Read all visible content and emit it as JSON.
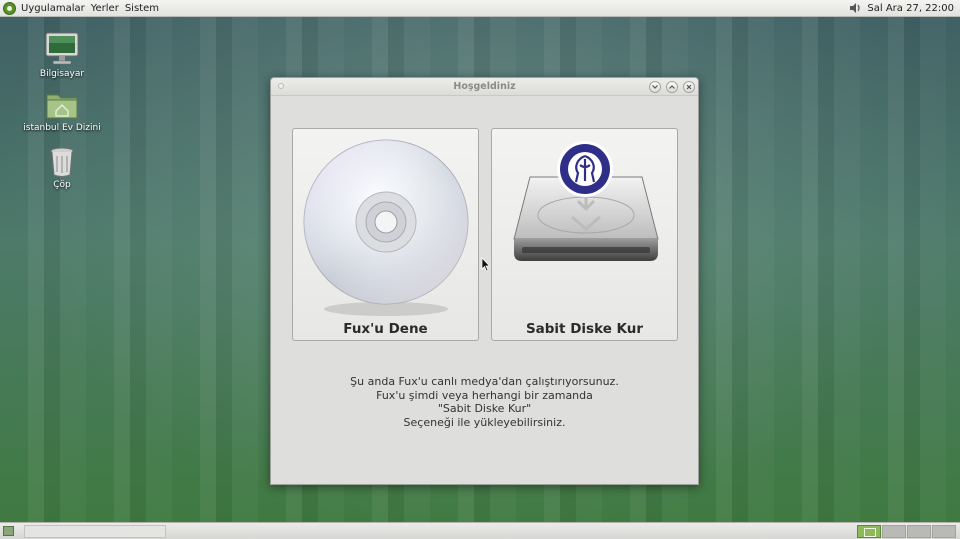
{
  "top_panel": {
    "menus": [
      "Uygulamalar",
      "Yerler",
      "Sistem"
    ],
    "clock": "Sal Ara 27, 22:00",
    "icons": [
      "distro-logo-icon",
      "volume-icon"
    ]
  },
  "desktop": {
    "icons": [
      {
        "label": "Bilgisayar",
        "icon": "computer-icon"
      },
      {
        "label": "istanbul Ev Dizini",
        "icon": "home-folder-icon"
      },
      {
        "label": "Çöp",
        "icon": "trash-icon"
      }
    ]
  },
  "window": {
    "title": "Hoşgeldiniz",
    "controls": [
      "minimize-icon",
      "maximize-icon",
      "close-icon"
    ],
    "options": [
      {
        "label": "Fux'u Dene",
        "icon": "cd-disc-icon"
      },
      {
        "label": "Sabit Diske Kur",
        "icon": "hard-disk-install-icon"
      }
    ],
    "info_lines": [
      "Şu anda Fux'u canlı medya'dan çalıştırıyorsunuz.",
      "Fux'u şimdi veya herhangi bir zamanda",
      "\"Sabit Diske Kur\"",
      "Seçeneği ile yükleyebilirsiniz."
    ]
  },
  "bottom_panel": {
    "workspaces": 4,
    "active_workspace": 1
  },
  "colors": {
    "accent_green": "#8db85b",
    "emblem_blue": "#2f2f8a"
  }
}
